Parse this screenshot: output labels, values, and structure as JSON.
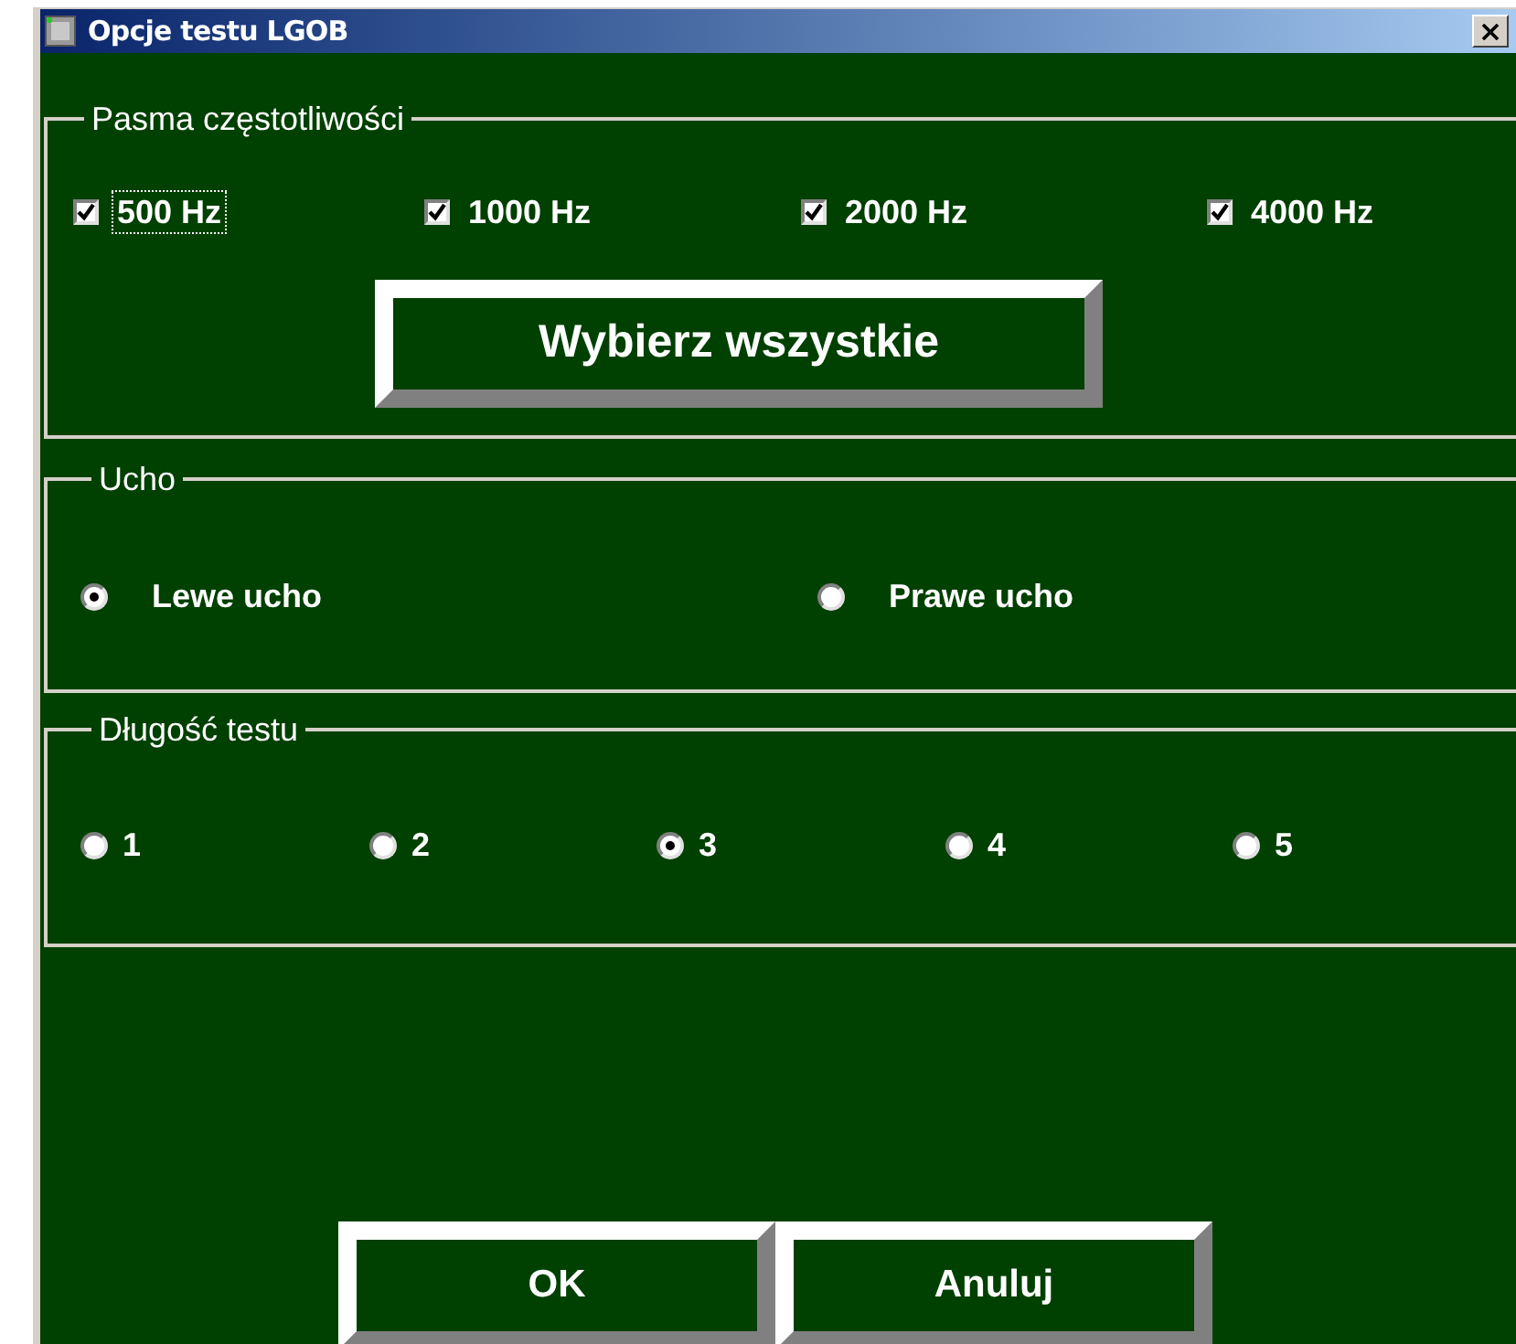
{
  "window": {
    "title": "Opcje testu LGOB"
  },
  "frequency_group": {
    "title": "Pasma częstotliwości",
    "options": [
      {
        "label": "500 Hz",
        "checked": true,
        "focused": true
      },
      {
        "label": "1000 Hz",
        "checked": true,
        "focused": false
      },
      {
        "label": "2000 Hz",
        "checked": true,
        "focused": false
      },
      {
        "label": "4000 Hz",
        "checked": true,
        "focused": false
      }
    ],
    "select_all_button": "Wybierz wszystkie"
  },
  "ear_group": {
    "title": "Ucho",
    "options": [
      {
        "label": "Lewe ucho",
        "selected": true
      },
      {
        "label": "Prawe ucho",
        "selected": false
      }
    ]
  },
  "length_group": {
    "title": "Długość testu",
    "options": [
      {
        "label": "1",
        "selected": false
      },
      {
        "label": "2",
        "selected": false
      },
      {
        "label": "3",
        "selected": true
      },
      {
        "label": "4",
        "selected": false
      },
      {
        "label": "5",
        "selected": false
      }
    ]
  },
  "buttons": [
    "OK",
    "Anuluj"
  ]
}
